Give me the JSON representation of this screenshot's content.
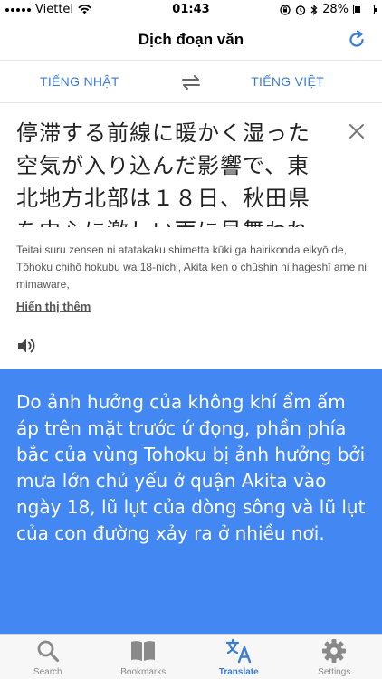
{
  "status_bar": {
    "carrier": "Viettel",
    "time": "01:43",
    "battery": "28%",
    "battery_level": 0.28
  },
  "nav": {
    "title": "Dịch đoạn văn",
    "refresh_icon": "refresh-icon"
  },
  "languages": {
    "source": "TIẾNG NHẬT",
    "target": "TIẾNG VIỆT",
    "swap_icon": "swap-arrows-icon"
  },
  "source": {
    "text": "停滞する前線に暖かく湿った空気が入り込んだ影響で、東北地方北部は１８日、秋田県を中心に激しい雨に見舞われ",
    "romaji": "Teitai suru zensen ni atatakaku shimetta kūki ga hairikonda eikyō de, Tōhoku chihō hokubu wa 18-nichi, Akita ken o chūshin ni hageshī ame ni mimaware,",
    "show_more": "Hiển thị thêm",
    "close_icon": "close-icon",
    "speaker_icon": "speaker-icon"
  },
  "translation": {
    "text": "Do ảnh hưởng của không khí ẩm ấm áp trên mặt trước ứ đọng, phần phía bắc của vùng Tohoku bị ảnh hưởng bởi mưa lớn chủ yếu ở quận Akita vào ngày 18, lũ lụt của dòng sông và lũ lụt của con đường xảy ra ở nhiều nơi."
  },
  "tabs": [
    {
      "label": "Search",
      "icon": "search-icon",
      "active": false
    },
    {
      "label": "Bookmarks",
      "icon": "bookmarks-icon",
      "active": false
    },
    {
      "label": "Translate",
      "icon": "translate-icon",
      "active": true
    },
    {
      "label": "Settings",
      "icon": "gear-icon",
      "active": false
    }
  ],
  "colors": {
    "accent": "#3a7bd5",
    "translation_bg": "#4388f2",
    "tab_inactive": "#8a8a8a"
  }
}
